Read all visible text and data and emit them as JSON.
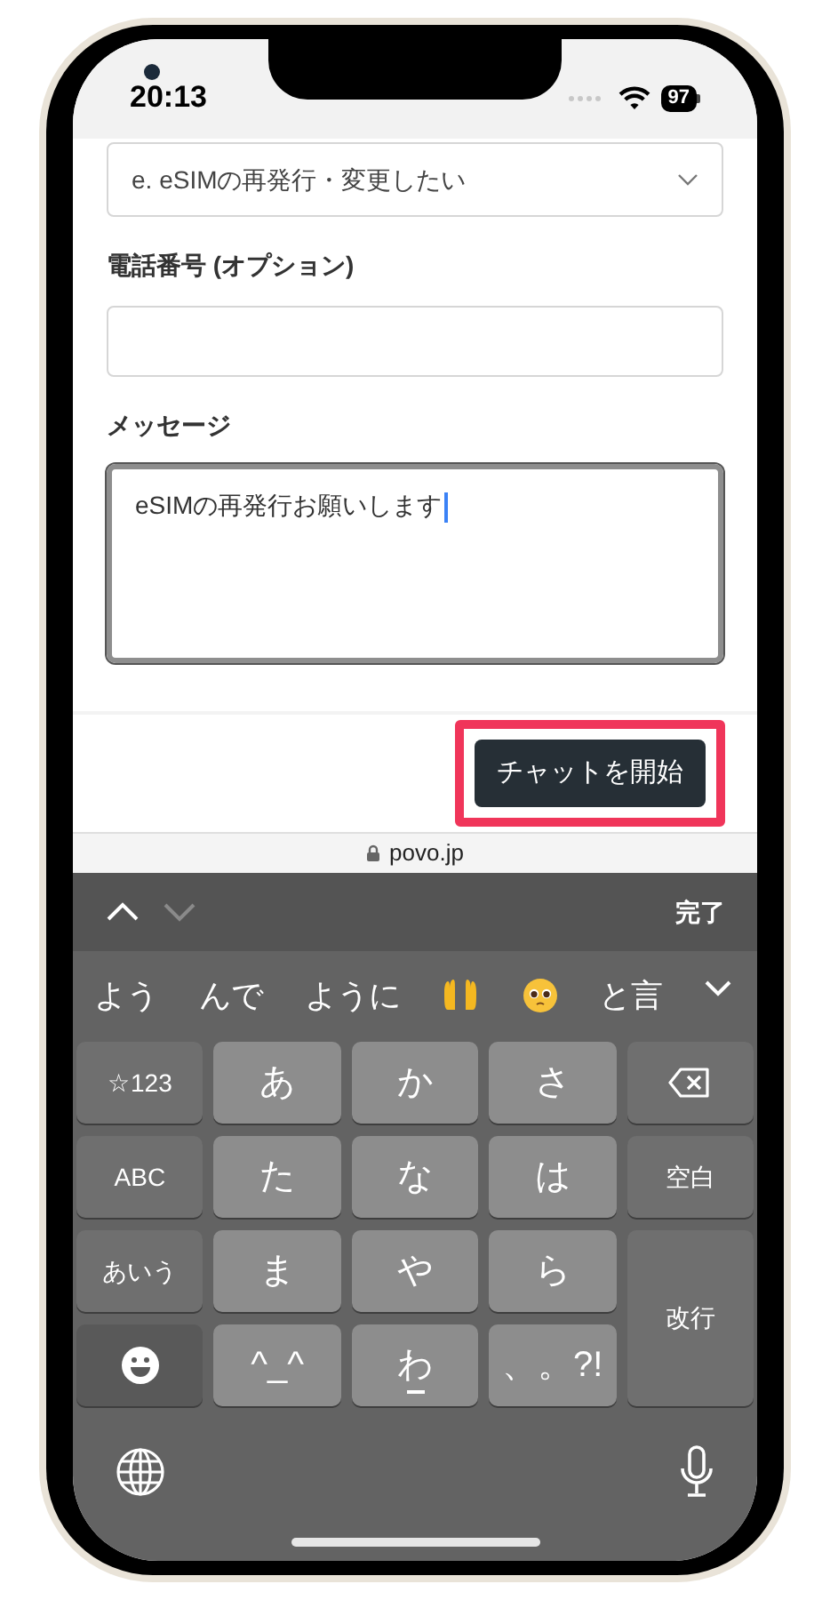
{
  "status_bar": {
    "time": "20:13",
    "battery": "97"
  },
  "form": {
    "topic_select": {
      "value": "e. eSIMの再発行・変更したい"
    },
    "phone_field": {
      "label": "電話番号 (オプション)"
    },
    "message_field": {
      "label": "メッセージ",
      "value": "eSIMの再発行お願いします",
      "focused": true
    }
  },
  "footer": {
    "start_chat_button": {
      "label": "チャットを開始",
      "highlighted": true
    }
  },
  "url_bar": {
    "domain": "povo.jp"
  },
  "keyboard": {
    "toolbar": {
      "done": "完了"
    },
    "candidates": [
      {
        "kind": "text",
        "text": "よう"
      },
      {
        "kind": "text",
        "text": "んで"
      },
      {
        "kind": "text",
        "text": "ように"
      },
      {
        "kind": "hands"
      },
      {
        "kind": "face"
      },
      {
        "kind": "text",
        "text": "と言"
      }
    ],
    "keys": [
      {
        "kind": "fn",
        "label": "☆123"
      },
      {
        "kind": "kana",
        "label": "あ"
      },
      {
        "kind": "kana",
        "label": "か"
      },
      {
        "kind": "kana",
        "label": "さ"
      },
      {
        "kind": "delete"
      },
      {
        "kind": "fn",
        "label": "ABC"
      },
      {
        "kind": "kana",
        "label": "た"
      },
      {
        "kind": "kana",
        "label": "な"
      },
      {
        "kind": "kana",
        "label": "は"
      },
      {
        "kind": "fn",
        "label": "空白"
      },
      {
        "kind": "fn",
        "label": "あいう"
      },
      {
        "kind": "kana",
        "label": "ま"
      },
      {
        "kind": "kana",
        "label": "や"
      },
      {
        "kind": "kana",
        "label": "ら"
      },
      {
        "kind": "return",
        "label": "改行"
      },
      {
        "kind": "emoji"
      },
      {
        "kind": "kana",
        "label": "^_^"
      },
      {
        "kind": "kana",
        "label": "わ",
        "underscore": true
      },
      {
        "kind": "kana",
        "label": "、。?!"
      }
    ]
  }
}
